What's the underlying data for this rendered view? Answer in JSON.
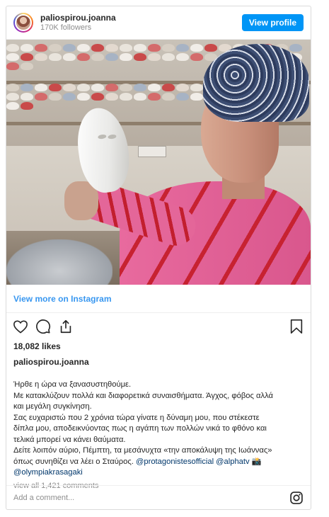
{
  "header": {
    "username": "paliospirou.joanna",
    "followers": "170K followers",
    "view_profile_label": "View profile"
  },
  "post": {
    "view_more_label": "View more on Instagram",
    "likes": "18,082 likes",
    "caption_username": "paliospirou.joanna",
    "caption_lines": [
      "Ήρθε η ώρα να ξανασυστηθούμε.",
      "Με κατακλύζουν πολλά και διαφορετικά συναισθήματα. Άγχος, φόβος αλλά",
      "και μεγάλη συγκίνηση.",
      "Σας ευχαριστώ που 2 χρόνια τώρα γίνατε η δύναμη μου, που στέκεστε",
      "δίπλα μου, αποδεικνύοντας πως η αγάπη των πολλών νικά το φθόνο και",
      "τελικά μπορεί να κάνει θαύματα.",
      "Δείτε λοιπόν αύριο, Πέμπτη, τα μεσάνυχτα «την αποκάλυψη της Ιωάννας»",
      "όπως συνηθίζει να λέει ο Σταύρος."
    ],
    "mentions": [
      "@protagonistesofficial",
      "@alphatv",
      "📸",
      "@olympiakrasagaki"
    ],
    "view_comments_label": "view all 1,421 comments"
  },
  "comment_box": {
    "placeholder": "Add a comment..."
  },
  "icons": {
    "like": "heart-icon",
    "comment": "comment-icon",
    "share": "share-icon",
    "save": "bookmark-icon",
    "instagram": "instagram-logo-icon"
  },
  "colors": {
    "accent": "#0095f6",
    "link": "#3897f0",
    "mention": "#00376b",
    "muted": "#8e8e8e"
  }
}
